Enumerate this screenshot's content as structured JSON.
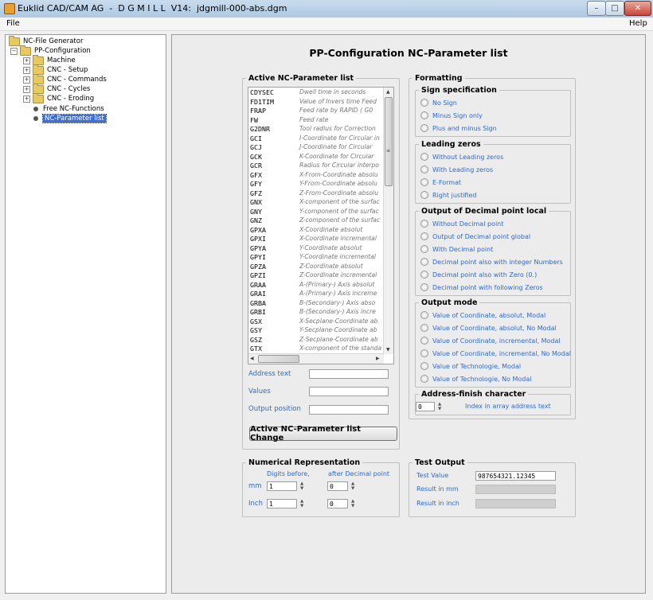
{
  "window": {
    "title": "Euklid CAD/CAM AG  -  D G M I L L  V14:  jdgmill-000-abs.dgm",
    "minimize": "–",
    "maximize": "□",
    "close": "✕"
  },
  "menu": {
    "file": "File",
    "help": "Help"
  },
  "tree": {
    "root": "NC-File Generator",
    "config": "PP-Configuration",
    "items": [
      "Machine",
      "CNC - Setup",
      "CNC - Commands",
      "CNC - Cycles",
      "CNC - Eroding",
      "Free NC-Functions",
      "NC-Parameter list"
    ],
    "selected": "NC-Parameter list"
  },
  "page_title": "PP-Configuration NC-Parameter list",
  "active_list": {
    "legend": "Active NC-Parameter list",
    "rows": [
      {
        "code": "CDYSEC",
        "desc": "Dwell time in seconds"
      },
      {
        "code": "FD1TIM",
        "desc": "Value of Invers time Feed"
      },
      {
        "code": "FRAP",
        "desc": "Feed rate by RAPID ( G0"
      },
      {
        "code": "FW",
        "desc": "Feed rate"
      },
      {
        "code": "G2DNR",
        "desc": "Tool radius for Correction"
      },
      {
        "code": "GCI",
        "desc": "I-Coordinate for Circular in"
      },
      {
        "code": "GCJ",
        "desc": "J-Coordinate for Circular"
      },
      {
        "code": "GCK",
        "desc": "K-Coordinate for Circular"
      },
      {
        "code": "GCR",
        "desc": "Radius for Circular interpo"
      },
      {
        "code": "GFX",
        "desc": "X-From-Coordinate absolu"
      },
      {
        "code": "GFY",
        "desc": "Y-From-Coordinate absolu"
      },
      {
        "code": "GFZ",
        "desc": "Z-From-Coordinate absolu"
      },
      {
        "code": "GNX",
        "desc": "X-component of the surfac"
      },
      {
        "code": "GNY",
        "desc": "Y-component of the surfac"
      },
      {
        "code": "GNZ",
        "desc": "Z-component of the surfac"
      },
      {
        "code": "GPXA",
        "desc": "X-Coordinate absolut"
      },
      {
        "code": "GPXI",
        "desc": "X-Coordinate incremental"
      },
      {
        "code": "GPYA",
        "desc": "Y-Coordinate absolut"
      },
      {
        "code": "GPYI",
        "desc": "Y-Coordinate incremental"
      },
      {
        "code": "GPZA",
        "desc": "Z-Coordinate absolut"
      },
      {
        "code": "GPZI",
        "desc": "Z-Coordinate incremental"
      },
      {
        "code": "GRAA",
        "desc": "A-(Primary-) Axis absolut"
      },
      {
        "code": "GRAI",
        "desc": "A-(Primary-) Axis increme"
      },
      {
        "code": "GRBA",
        "desc": "B-(Secondary-) Axis abso"
      },
      {
        "code": "GRBI",
        "desc": "B-(Secondary-) Axis incre"
      },
      {
        "code": "GSX",
        "desc": "X-Secplane-Coordinate ab"
      },
      {
        "code": "GSY",
        "desc": "Y-Secplane-Coordinate ab"
      },
      {
        "code": "GSZ",
        "desc": "Z-Secplane-Coordinate ab"
      },
      {
        "code": "GTX",
        "desc": "X-component of the standa"
      }
    ],
    "address_text_label": "Address text",
    "values_label": "Values",
    "output_position_label": "Output position",
    "address_text_value": "",
    "values_value": "",
    "output_position_value": "",
    "change_button": "Active NC-Parameter list  Change"
  },
  "numerical": {
    "legend": "Numerical Representation",
    "digits_before": "Digits before,",
    "after_decimal": "after Decimal point",
    "mm_label": "mm",
    "inch_label": "Inch",
    "mm_before": "1",
    "mm_after": "0",
    "inch_before": "1",
    "inch_after": "0"
  },
  "formatting": {
    "legend": "Formatting",
    "sign": {
      "legend": "Sign specification",
      "options": [
        "No Sign",
        "Minus Sign only",
        "Plus and minus Sign"
      ]
    },
    "leading": {
      "legend": "Leading zeros",
      "options": [
        "Without Leading zeros",
        "With Leading zeros",
        "E-Format",
        "Right justified"
      ]
    },
    "decimal": {
      "legend": "Output of Decimal point local",
      "options": [
        "Without Decimal point",
        "Output of Decimal point global",
        "With Decimal point",
        "Decimal point also with integer Numbers",
        "Decimal point also with Zero (0.)",
        "Decimal point with following Zeros"
      ]
    },
    "mode": {
      "legend": "Output mode",
      "options": [
        "Value of Coordinate, absolut, Modal",
        "Value of Coordinate, absolut, No Modal",
        "Value of Coordinate, incremental, Modal",
        "Value of Coordinate, incremental, No Modal",
        "Value of Technologie, Modal",
        "Value of Technologie, No Modal"
      ]
    },
    "address_finish": {
      "legend": "Address-finish character",
      "value": "0",
      "hint": "Index in array address text"
    }
  },
  "test_output": {
    "legend": "Test Output",
    "test_value_label": "Test Value",
    "test_value": "987654321.12345",
    "result_mm_label": "Result in mm",
    "result_inch_label": "Result in inch",
    "result_mm": "",
    "result_inch": ""
  }
}
